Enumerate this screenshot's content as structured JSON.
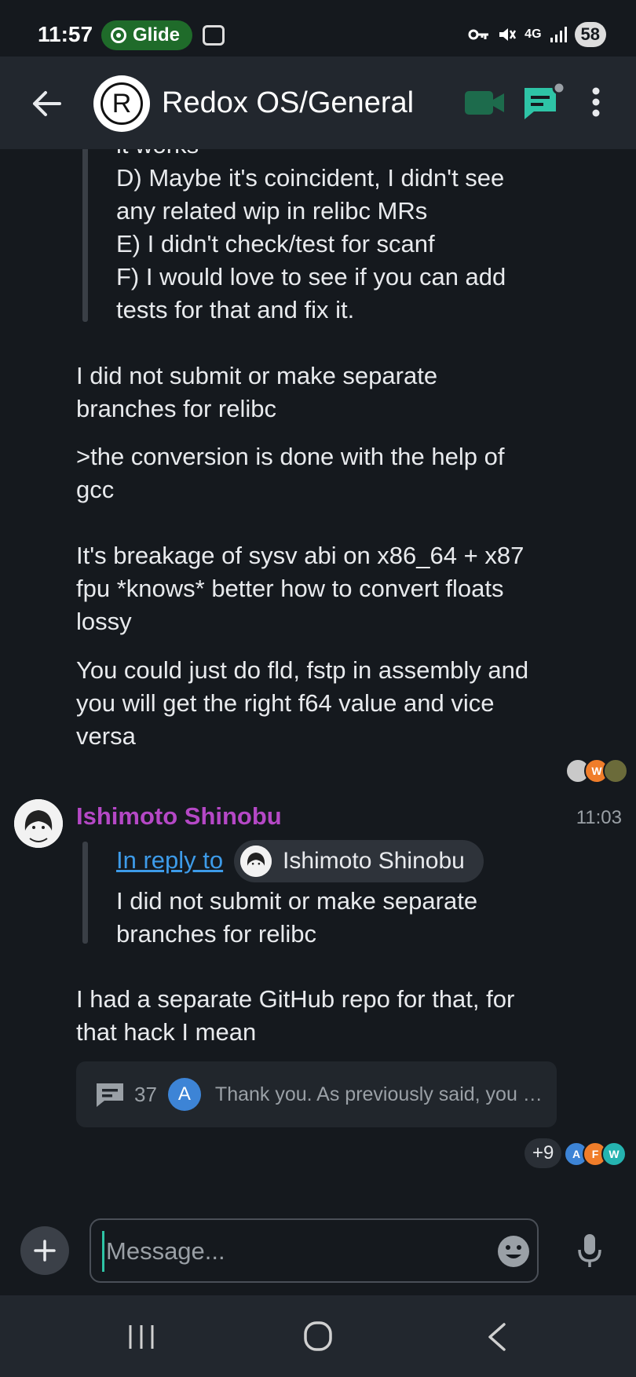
{
  "status_bar": {
    "time": "11:57",
    "app_pill": "Glide",
    "network": "4G",
    "battery": "58"
  },
  "header": {
    "room_avatar_letter": "R",
    "room_title": "Redox OS/General"
  },
  "timeline": {
    "quoted_partial": {
      "clipped_line": "it works",
      "lines": [
        "D) Maybe it's coincident, I didn't see",
        "any related wip in relibc MRs",
        "E) I didn't check/test for scanf",
        "F) I would love to see if you can add",
        "tests for that and fix it."
      ]
    },
    "messages": [
      {
        "lines": [
          "I did not submit or make separate",
          "branches for relibc"
        ]
      },
      {
        "lines": [
          ">the conversion is done with the help of",
          "gcc",
          "",
          "It's breakage of sysv abi on x86_64 + x87",
          "fpu *knows* better how to convert floats",
          "lossy"
        ]
      },
      {
        "lines": [
          "You could just do fld, fstp in assembly and",
          "you will get the right f64 value and vice",
          "versa"
        ]
      }
    ],
    "read_receipts_1": [
      {
        "initial": "",
        "color": "#c9c9c9"
      },
      {
        "initial": "W",
        "color": "#f07d2a"
      },
      {
        "initial": "",
        "color": "#6b6b3a"
      }
    ],
    "event": {
      "sender": "Ishimoto Shinobu",
      "time": "11:03",
      "reply_link": "In reply to",
      "reply_to_name": "Ishimoto Shinobu",
      "reply_quote_lines": [
        "I did not submit or make separate",
        "branches for relibc"
      ],
      "body_lines": [
        "I had a separate GitHub repo for that, for",
        "that hack I mean"
      ]
    },
    "thread": {
      "count": "37",
      "avatar_initial": "A",
      "preview": "Thank you. As previously said, you …"
    },
    "read_receipts_2": {
      "extra": "+9",
      "avatars": [
        {
          "initial": "A",
          "color": "#3d84d6"
        },
        {
          "initial": "F",
          "color": "#f07d2a"
        },
        {
          "initial": "W",
          "color": "#25b3b0"
        }
      ]
    }
  },
  "composer": {
    "placeholder": "Message..."
  },
  "colors": {
    "background": "#15191e",
    "appbar": "#22272e",
    "sender_name": "#b548c6",
    "link": "#3d9be9",
    "accent_green": "#2ec4a6"
  }
}
